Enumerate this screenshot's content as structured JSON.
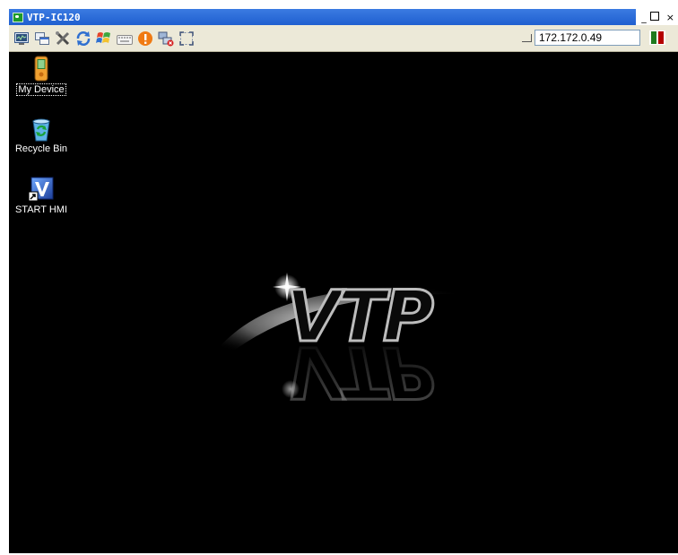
{
  "window": {
    "title": "VTP-IC120",
    "controls": {
      "minimize": "_",
      "maximize": "□",
      "close": "×"
    }
  },
  "toolbar": {
    "buttons": [
      {
        "name": "monitor-icon"
      },
      {
        "name": "windows-icon"
      },
      {
        "name": "tools-icon"
      },
      {
        "name": "refresh-icon"
      },
      {
        "name": "start-flag-icon"
      },
      {
        "name": "keyboard-icon"
      },
      {
        "name": "warning-icon"
      },
      {
        "name": "network-disconnect-icon"
      },
      {
        "name": "fullscreen-icon"
      }
    ],
    "ip_address": "172.172.0.49",
    "status_colors": [
      "#1f7a1f",
      "#b40000"
    ]
  },
  "desktop": {
    "icons": [
      {
        "label": "My Device"
      },
      {
        "label": "Recycle Bin"
      },
      {
        "label": "START HMI"
      }
    ],
    "logo_text": "VTP"
  }
}
